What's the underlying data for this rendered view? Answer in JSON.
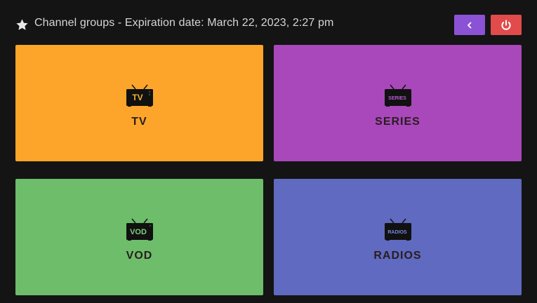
{
  "header": {
    "title": "Channel groups - Expiration date: March 22, 2023, 2:27 pm",
    "icon": "star-icon"
  },
  "buttons": {
    "back": {
      "icon": "chevron-left-icon",
      "color": "#8b52d6"
    },
    "power": {
      "icon": "power-icon",
      "color": "#e24b4b"
    }
  },
  "tiles": [
    {
      "label": "TV",
      "screen_text": "TV",
      "color": "#fca52a",
      "screen_text_color": "#f2b22a"
    },
    {
      "label": "SERIES",
      "screen_text": "SERIES",
      "color": "#a848bb",
      "screen_text_color": "#b45bd0"
    },
    {
      "label": "VOD",
      "screen_text": "VOD",
      "color": "#6dbd6b",
      "screen_text_color": "#7fd07c"
    },
    {
      "label": "RADIOS",
      "screen_text": "RADIOS",
      "color": "#5f6ac0",
      "screen_text_color": "#7b86e0"
    }
  ]
}
